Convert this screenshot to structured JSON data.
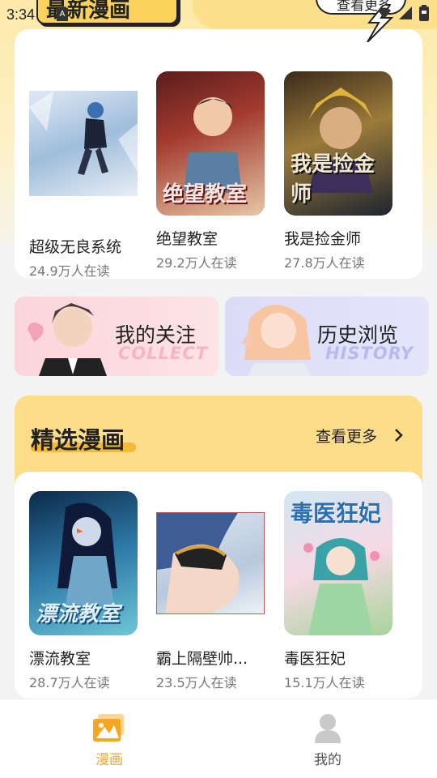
{
  "status_bar": {
    "time": "3:34",
    "notification_badge": "A"
  },
  "latest": {
    "title": "最新漫画",
    "more_label": "查看更多",
    "comics": [
      {
        "title": "超级无良系统",
        "readers": "24.9万人在读"
      },
      {
        "title": "绝望教室",
        "readers": "29.2万人在读",
        "cover_text": "绝望教室"
      },
      {
        "title": "我是捡金师",
        "readers": "27.8万人在读",
        "cover_text": "我是捡金师"
      }
    ]
  },
  "shortcuts": {
    "follow": {
      "label": "我的关注",
      "watermark": "COLLECT"
    },
    "history": {
      "label": "历史浏览",
      "watermark": "HISTORY"
    }
  },
  "featured": {
    "title": "精选漫画",
    "more_label": "查看更多",
    "comics": [
      {
        "title": "漂流教室",
        "readers": "28.7万人在读",
        "cover_text": "漂流教室"
      },
      {
        "title": "霸上隔壁帅...",
        "readers": "23.5万人在读"
      },
      {
        "title": "毒医狂妃",
        "readers": "15.1万人在读",
        "cover_text": "毒医狂妃"
      }
    ]
  },
  "bottom_nav": {
    "items": [
      {
        "label": "漫画",
        "icon": "comics-icon",
        "active": true
      },
      {
        "label": "我的",
        "icon": "profile-icon",
        "active": false
      }
    ]
  },
  "colors": {
    "accent": "#f5a623",
    "header_yellow": "#fcdd8a",
    "follow_bg": "#fbd5dc",
    "history_bg": "#dcdcf8"
  }
}
